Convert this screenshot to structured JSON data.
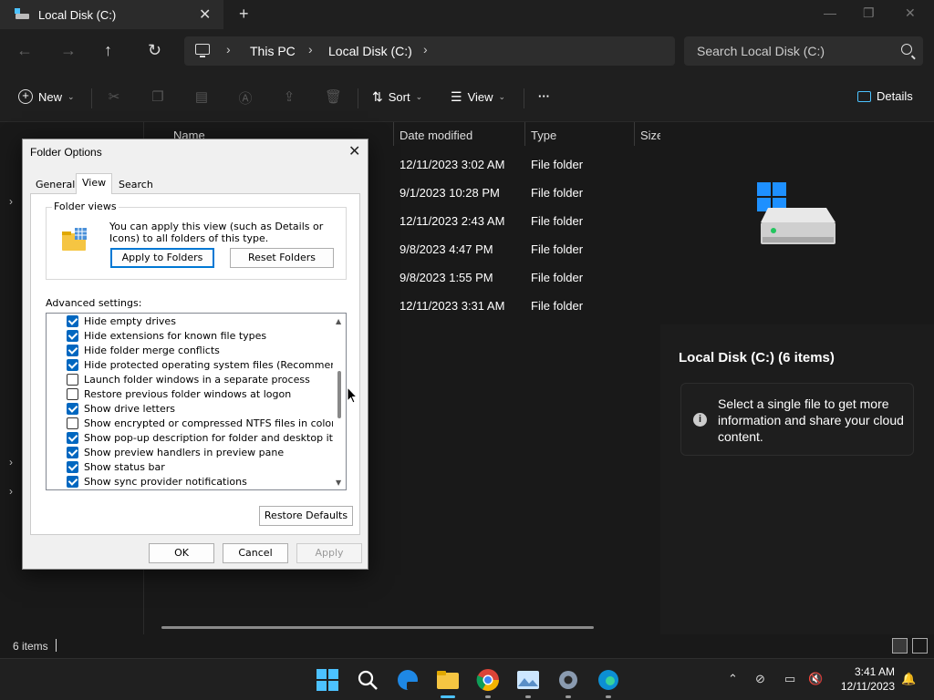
{
  "window": {
    "tab_title": "Local Disk (C:)",
    "new_tab": "+"
  },
  "address": {
    "crumbs": [
      "This PC",
      "Local Disk (C:)"
    ],
    "search_placeholder": "Search Local Disk (C:)"
  },
  "toolbar": {
    "new_label": "New",
    "sort_label": "Sort",
    "view_label": "View",
    "more_label": "···",
    "details_label": "Details"
  },
  "file_list": {
    "columns": [
      "Name",
      "Date modified",
      "Type",
      "Size"
    ],
    "rows": [
      {
        "date": "12/11/2023 3:02 AM",
        "type": "File folder"
      },
      {
        "date": "9/1/2023 10:28 PM",
        "type": "File folder"
      },
      {
        "date": "12/11/2023 2:43 AM",
        "type": "File folder"
      },
      {
        "date": "9/8/2023 4:47 PM",
        "type": "File folder"
      },
      {
        "date": "9/8/2023 1:55 PM",
        "type": "File folder"
      },
      {
        "date": "12/11/2023 3:31 AM",
        "type": "File folder"
      }
    ]
  },
  "details_pane": {
    "title": "Local Disk (C:) (6 items)",
    "info": "Select a single file to get more information and share your cloud content."
  },
  "status_bar": {
    "count": "6 items"
  },
  "dialog": {
    "title": "Folder Options",
    "tabs": [
      "General",
      "View",
      "Search"
    ],
    "active_tab": "View",
    "folder_views_label": "Folder views",
    "folder_views_text": "You can apply this view (such as Details or Icons) to all folders of this type.",
    "apply_to_folders": "Apply to Folders",
    "reset_folders": "Reset Folders",
    "advanced_label": "Advanced settings:",
    "settings": [
      {
        "label": "Hide empty drives",
        "checked": true
      },
      {
        "label": "Hide extensions for known file types",
        "checked": true
      },
      {
        "label": "Hide folder merge conflicts",
        "checked": true
      },
      {
        "label": "Hide protected operating system files (Recommended)",
        "checked": true
      },
      {
        "label": "Launch folder windows in a separate process",
        "checked": false
      },
      {
        "label": "Restore previous folder windows at logon",
        "checked": false
      },
      {
        "label": "Show drive letters",
        "checked": true
      },
      {
        "label": "Show encrypted or compressed NTFS files in color",
        "checked": false
      },
      {
        "label": "Show pop-up description for folder and desktop items",
        "checked": true
      },
      {
        "label": "Show preview handlers in preview pane",
        "checked": true
      },
      {
        "label": "Show status bar",
        "checked": true
      },
      {
        "label": "Show sync provider notifications",
        "checked": true
      }
    ],
    "restore_defaults": "Restore Defaults",
    "ok": "OK",
    "cancel": "Cancel",
    "apply": "Apply"
  },
  "taskbar": {
    "time": "3:41 AM",
    "date": "12/11/2023",
    "icons": [
      "start-icon",
      "search-icon",
      "edge-beta-icon",
      "file-explorer-icon",
      "chrome-icon",
      "photos-icon",
      "settings-icon",
      "edge-icon"
    ]
  },
  "colors": {
    "accent": "#0067c0",
    "explorer_bg": "#191919",
    "dialog_bg": "#f0f0f0"
  }
}
